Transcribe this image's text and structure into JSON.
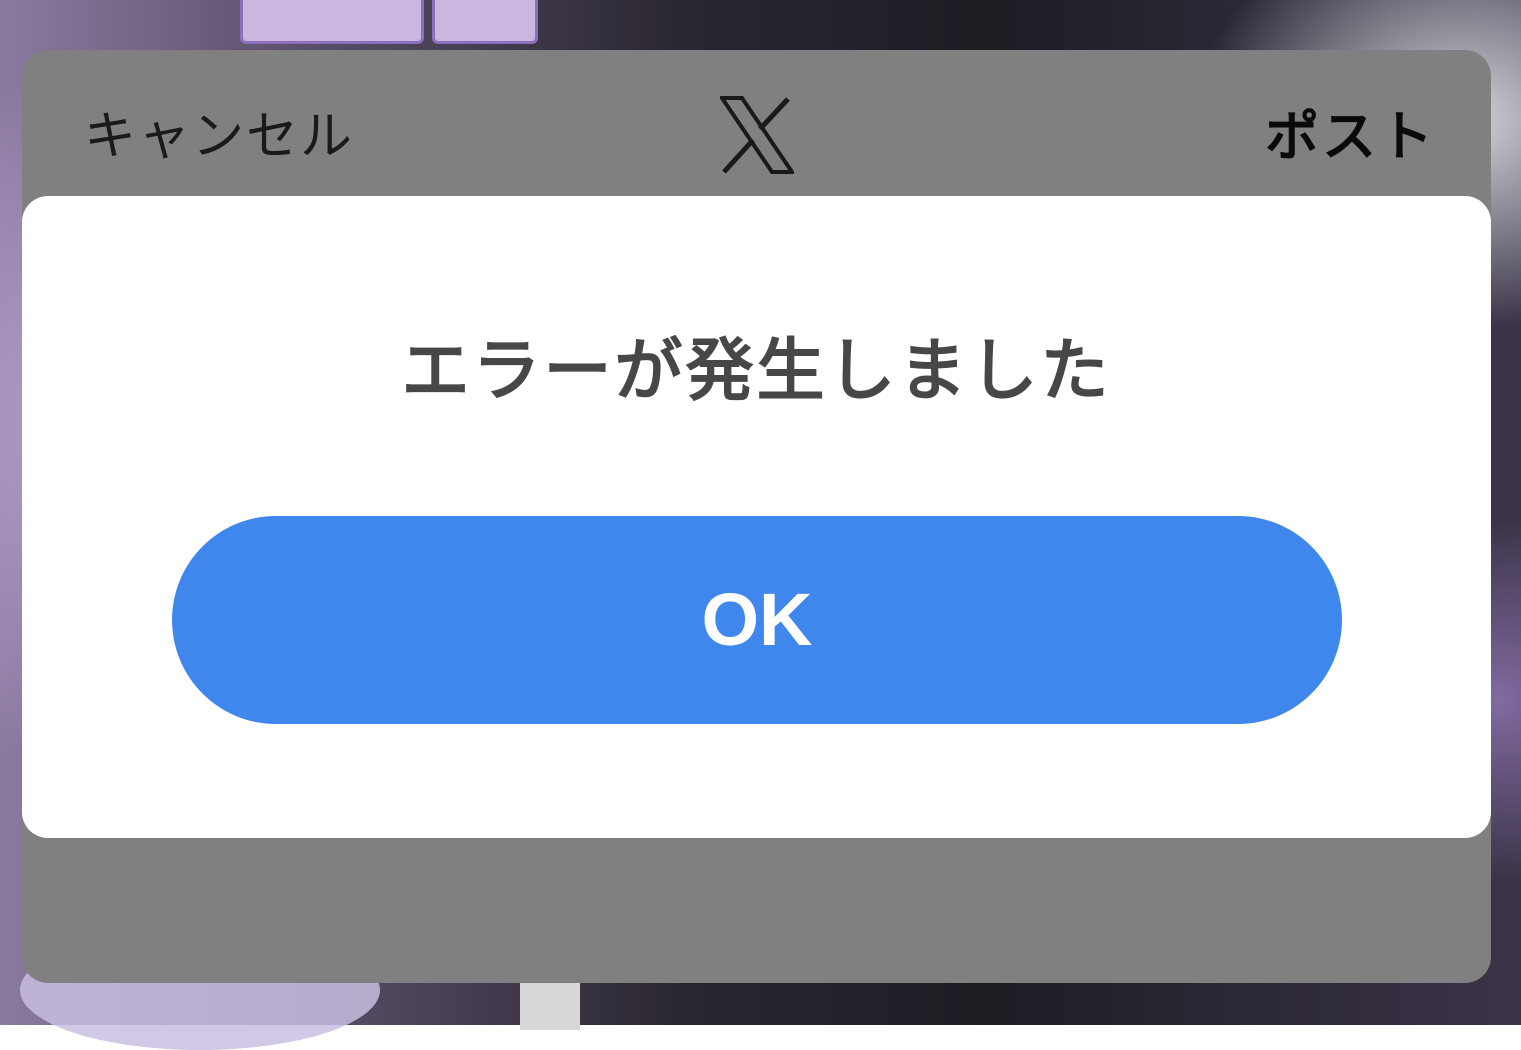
{
  "header": {
    "cancel_label": "キャンセル",
    "logo_icon": "x-logo-icon",
    "post_label": "ポスト"
  },
  "alert": {
    "message": "エラーが発生しました",
    "ok_label": "OK"
  },
  "colors": {
    "sheet_dim": "#808080",
    "alert_background": "#ffffff",
    "ok_button": "#3f87ec",
    "message_text": "#474747"
  }
}
